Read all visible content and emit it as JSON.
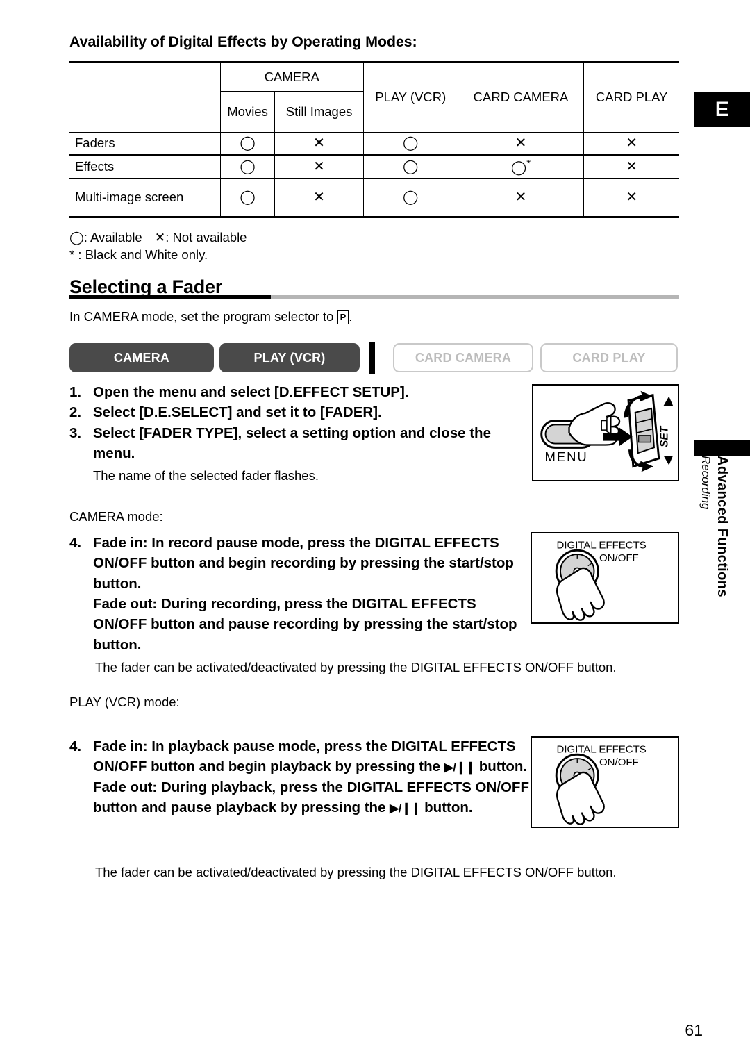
{
  "page": {
    "number": "61",
    "edge_tab_letter": "E",
    "side_text_bold": "Advanced Functions",
    "side_text_italic": "Recording"
  },
  "availability": {
    "heading": "Availability of Digital Effects by Operating Modes:",
    "columns": {
      "camera_group": "CAMERA",
      "camera_movies": "Movies",
      "camera_still": "Still Images",
      "play_vcr": "PLAY (VCR)",
      "card_camera": "CARD CAMERA",
      "card_play": "CARD PLAY"
    },
    "rows": [
      {
        "label": "Faders",
        "movies": "◯",
        "still": "✕",
        "play": "◯",
        "card_camera": "✕",
        "card_play": "✕",
        "card_camera_note": ""
      },
      {
        "label": "Effects",
        "movies": "◯",
        "still": "✕",
        "play": "◯",
        "card_camera": "◯",
        "card_play": "✕",
        "card_camera_note": "*"
      },
      {
        "label": "Multi-image screen",
        "movies": "◯",
        "still": "✕",
        "play": "◯",
        "card_camera": "✕",
        "card_play": "✕",
        "card_camera_note": ""
      }
    ],
    "legend_available_symbol": "◯",
    "legend_available_text": ": Available",
    "legend_not_available_symbol": "✕",
    "legend_not_available_text": ": Not available",
    "legend_footnote": "* : Black and White only."
  },
  "section": {
    "title": "Selecting a Fader",
    "intro_before": "In CAMERA mode, set the program selector to ",
    "intro_icon": "P",
    "intro_after": "."
  },
  "mode_badges": [
    {
      "label": "CAMERA",
      "state": "on"
    },
    {
      "label": "PLAY (VCR)",
      "state": "on"
    },
    {
      "label": "CARD CAMERA",
      "state": "off"
    },
    {
      "label": "CARD PLAY",
      "state": "off"
    }
  ],
  "steps_main": [
    {
      "num": "1.",
      "text": "Open the menu and select [D.EFFECT SETUP]."
    },
    {
      "num": "2.",
      "text": "Select [D.E.SELECT] and set it to [FADER]."
    },
    {
      "num": "3.",
      "text": "Select [FADER TYPE], select a setting option and close the menu."
    }
  ],
  "steps_main_note": "The name of the selected fader flashes.",
  "camera_section": {
    "mode_label": "CAMERA mode:",
    "step_num": "4.",
    "line1": "Fade in: In record pause mode, press the DIGITAL EFFECTS ON/OFF button and begin recording by pressing the start/stop button.",
    "line2": "Fade out: During recording, press the DIGITAL EFFECTS ON/OFF button and pause recording by pressing the start/stop button.",
    "note": "The fader can be activated/deactivated by pressing the DIGITAL EFFECTS ON/OFF button."
  },
  "play_section": {
    "mode_label": "PLAY (VCR) mode:",
    "step_num": "4.",
    "line1_a": "Fade in: In playback pause mode, press the DIGITAL EFFECTS ON/OFF button and begin playback by pressing the ",
    "line1_glyph": "▶/❙❙",
    "line1_b": " button.",
    "line2_a": "Fade out: During playback, press the DIGITAL EFFECTS ON/OFF button and pause playback by pressing the ",
    "line2_glyph": "▶/❙❙",
    "line2_b": " button.",
    "note": "The fader can be activated/deactivated by pressing the DIGITAL EFFECTS ON/OFF button."
  },
  "illustrations": {
    "menu": {
      "button_label": "MENU",
      "dial_label": "SET"
    },
    "digital_effects_1": {
      "line1": "DIGITAL EFFECTS",
      "line2": "ON/OFF"
    },
    "digital_effects_2": {
      "line1": "DIGITAL EFFECTS",
      "line2": "ON/OFF"
    }
  },
  "colors": {
    "badge_active_bg": "#4a4a4a",
    "badge_inactive_border": "#c9c9c9",
    "badge_inactive_text": "#bdbdbd",
    "section_rule": "#b5b5b5"
  }
}
